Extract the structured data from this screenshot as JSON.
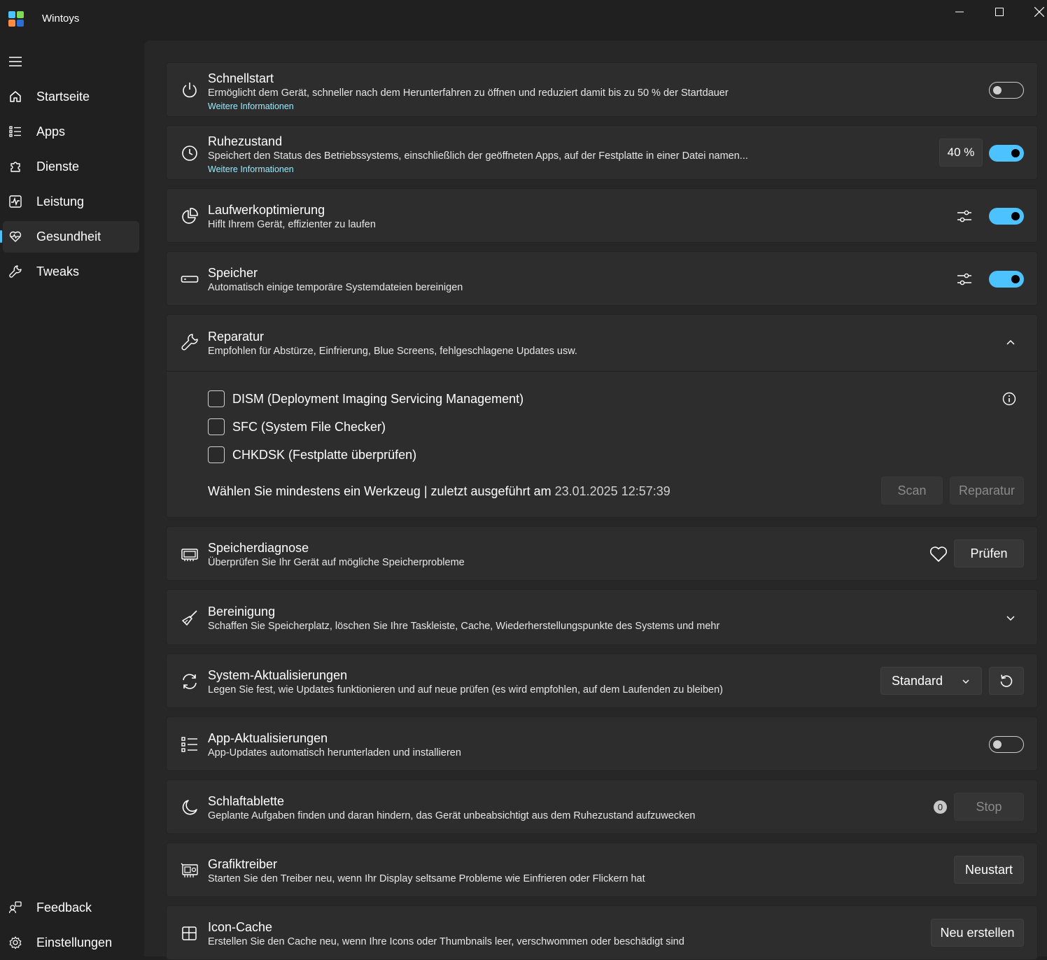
{
  "app": {
    "title": "Wintoys"
  },
  "sidebar": {
    "items": [
      {
        "label": "Startseite",
        "icon": "home-icon"
      },
      {
        "label": "Apps",
        "icon": "apps-list-icon"
      },
      {
        "label": "Dienste",
        "icon": "puzzle-icon"
      },
      {
        "label": "Leistung",
        "icon": "performance-icon"
      },
      {
        "label": "Gesundheit",
        "icon": "heart-pulse-icon",
        "selected": true
      },
      {
        "label": "Tweaks",
        "icon": "wrench-icon"
      }
    ],
    "footer": [
      {
        "label": "Feedback",
        "icon": "feedback-icon"
      },
      {
        "label": "Einstellungen",
        "icon": "gear-icon"
      }
    ]
  },
  "cards": {
    "schnellstart": {
      "title": "Schnellstart",
      "desc": "Ermöglicht dem Gerät, schneller nach dem Herunterfahren zu öffnen und reduziert damit bis zu 50 % der Startdauer",
      "link": "Weitere Informationen",
      "toggle": "off"
    },
    "ruhezustand": {
      "title": "Ruhezustand",
      "desc": "Speichert den Status des Betriebssystems, einschließlich der geöffneten Apps, auf der Festplatte in einer Datei namen...",
      "link": "Weitere Informationen",
      "value": "40 %",
      "toggle": "on"
    },
    "laufwerk": {
      "title": "Laufwerkoptimierung",
      "desc": "Hiflt Ihrem Gerät, effizienter zu laufen",
      "toggle": "on"
    },
    "speicher": {
      "title": "Speicher",
      "desc": "Automatisch einige temporäre Systemdateien bereinigen",
      "toggle": "on"
    },
    "reparatur": {
      "title": "Reparatur",
      "desc": "Empfohlen für Abstürze, Einfrierung, Blue Screens, fehlgeschlagene Updates usw.",
      "options": [
        "DISM (Deployment Imaging Servicing Management)",
        "SFC (System File Checker)",
        "CHKDSK (Festplatte überprüfen)"
      ],
      "status_prefix": "Wählen Sie mindestens ein Werkzeug | zuletzt ausgeführt am",
      "status_date": "23.01.2025 12:57:39",
      "scan_label": "Scan",
      "repair_label": "Reparatur"
    },
    "speicherdiagnose": {
      "title": "Speicherdiagnose",
      "desc": "Überprüfen Sie Ihr Gerät auf mögliche Speicherprobleme",
      "button": "Prüfen"
    },
    "bereinigung": {
      "title": "Bereinigung",
      "desc": "Schaffen Sie Speicherplatz, löschen Sie Ihre Taskleiste, Cache, Wiederherstellungspunkte des Systems und mehr"
    },
    "systemupdates": {
      "title": "System-Aktualisierungen",
      "desc": "Legen Sie fest, wie Updates funktionieren und auf neue prüfen (es wird empfohlen, auf dem Laufenden zu bleiben)",
      "select": "Standard"
    },
    "appupdates": {
      "title": "App-Aktualisierungen",
      "desc": "App-Updates automatisch herunterladen und installieren",
      "toggle": "off"
    },
    "schlaftablette": {
      "title": "Schlaftablette",
      "desc": "Geplante Aufgaben finden und daran hindern, das Gerät unbeabsichtigt aus dem Ruhezustand aufzuwecken",
      "badge": "0",
      "button": "Stop"
    },
    "grafiktreiber": {
      "title": "Grafiktreiber",
      "desc": "Starten Sie den Treiber neu, wenn Ihr Display seltsame Probleme wie Einfrieren oder Flickern hat",
      "button": "Neustart"
    },
    "iconcache": {
      "title": "Icon-Cache",
      "desc": "Erstellen Sie den Cache neu, wenn Ihre Icons oder Thumbnails leer, verschwommen oder beschädigt sind",
      "button": "Neu erstellen"
    }
  },
  "colors": {
    "accent": "#4cc2ff",
    "link": "#99ebff",
    "background": "#202020",
    "card": "#2d2d2d"
  }
}
